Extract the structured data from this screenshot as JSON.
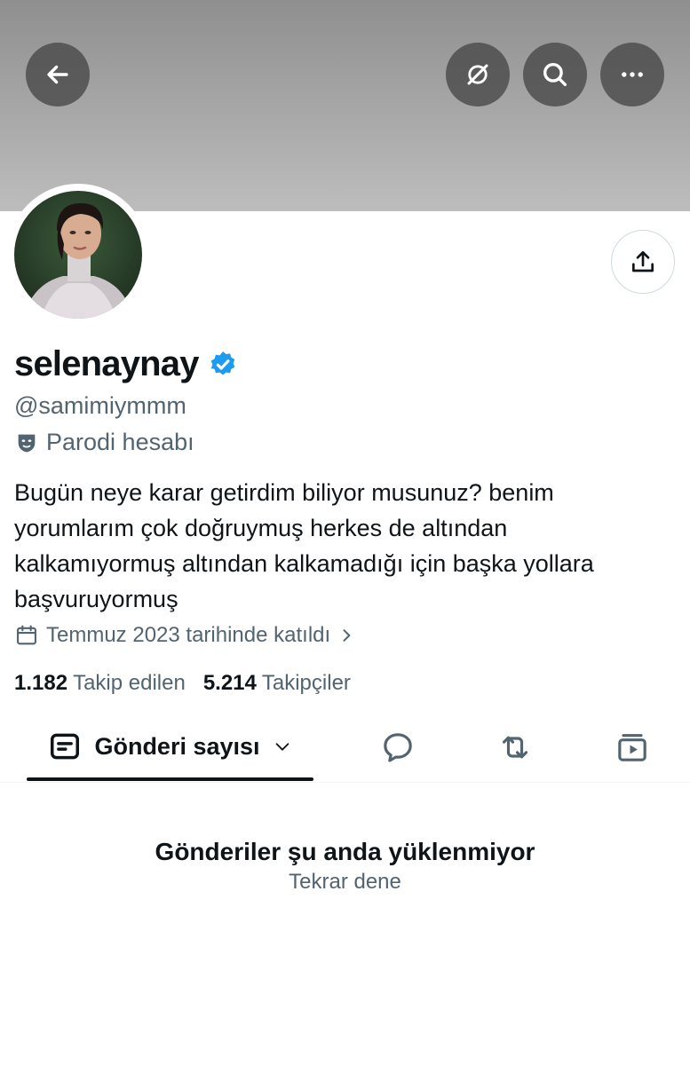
{
  "profile": {
    "display_name": "selenaynay",
    "handle": "@samimiymmm",
    "parody_label": "Parodi hesabı",
    "bio": "Bugün neye karar getirdim biliyor musunuz? benim yorumlarım çok doğruymuş herkes de altından kalkamıyormuş altından kalkamadığı için başka yollara başvuruyormuş",
    "joined": "Temmuz 2023 tarihinde katıldı",
    "following_count": "1.182",
    "following_label": "Takip edilen",
    "followers_count": "5.214",
    "followers_label": "Takipçiler"
  },
  "header_icons": [
    "back-arrow-icon",
    "grok-icon",
    "search-icon",
    "more-icon"
  ],
  "tabs": {
    "active_label": "Gönderi sayısı",
    "icons": [
      "posts-icon",
      "replies-icon",
      "reposts-icon",
      "media-icon"
    ]
  },
  "feed": {
    "error_title": "Gönderiler şu anda yüklenmiyor",
    "retry_label": "Tekrar dene"
  },
  "colors": {
    "verified_blue": "#1d9bf0",
    "secondary_text": "#536471",
    "primary_text": "#0f1419"
  }
}
